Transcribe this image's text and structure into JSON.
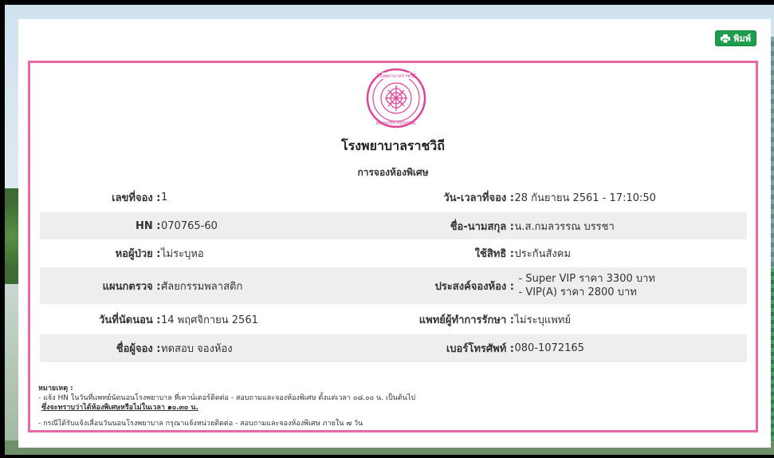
{
  "toolbar": {
    "print_label": "พิมพ์"
  },
  "header": {
    "hospital_name": "โรงพยาบาลราชวิถี",
    "subtitle": "การจองห้องพิเศษ",
    "logo_text_top": "โรงพยาบาลราชวิถี",
    "logo_text_bottom": "RAJAVITHI HOSPITAL"
  },
  "rows": [
    {
      "left": {
        "label": "เลขที่จอง :",
        "value": "1"
      },
      "right": {
        "label": "วัน-เวลาที่จอง :",
        "value": "28 กันยายน 2561 - 17:10:50"
      }
    },
    {
      "left": {
        "label": "HN :",
        "value": "070765-60"
      },
      "right": {
        "label": "ชื่อ-นามสกุล :",
        "value": "น.ส.กมลวรรณ บรรชา"
      }
    },
    {
      "left": {
        "label": "หอผู้ป่วย :",
        "value": "ไม่ระบุหอ"
      },
      "right": {
        "label": "ใช้สิทธิ :",
        "value": "ประกันสังคม"
      }
    },
    {
      "left": {
        "label": "แผนกตรวจ :",
        "value": "ศัลยกรรมพลาสติก"
      },
      "right": {
        "label": "ประสงค์จองห้อง :",
        "value_line1": "- Super VIP ราคา 3300 บาท",
        "value_line2": "- VIP(A) ราคา 2800 บาท"
      }
    },
    {
      "left": {
        "label": "วันที่นัดนอน :",
        "value": "14 พฤศจิกายน 2561"
      },
      "right": {
        "label": "แพทย์ผู้ทำการรักษา :",
        "value": "ไม่ระบุแพทย์"
      }
    },
    {
      "left": {
        "label": "ชื่อผู้จอง :",
        "value": "ทดสอบ จองห้อง"
      },
      "right": {
        "label": "เบอร์โทรศัพท์ :",
        "value": "080-1072165"
      }
    }
  ],
  "notes": {
    "title": "หมายเหตุ :",
    "line1": "- แจ้ง HN ในวันที่แพทย์นัดนอนโรงพยาบาล ที่เคาน์เตอร์ติดต่อ - สอบถามและจองห้องพิเศษ ตั้งแต่เวลา ๐๘.๐๐ น. เป็นต้นไป",
    "line2": "ซึ่งจะทราบว่าได้ห้องพิเศษหรือไม่ในเวลา ๑๐.๓๐ น.",
    "line3": "- กรณีได้รับแจ้งเลื่อนวันนอนโรงพยาบาล กรุณาแจ้งหน่วยติดต่อ - สอบถามและจองห้องพิเศษ ภายใน ๗ วัน"
  },
  "colors": {
    "frame": "#e868a8",
    "print_button": "#1e9e4c",
    "row_shade": "#eeeeee"
  }
}
